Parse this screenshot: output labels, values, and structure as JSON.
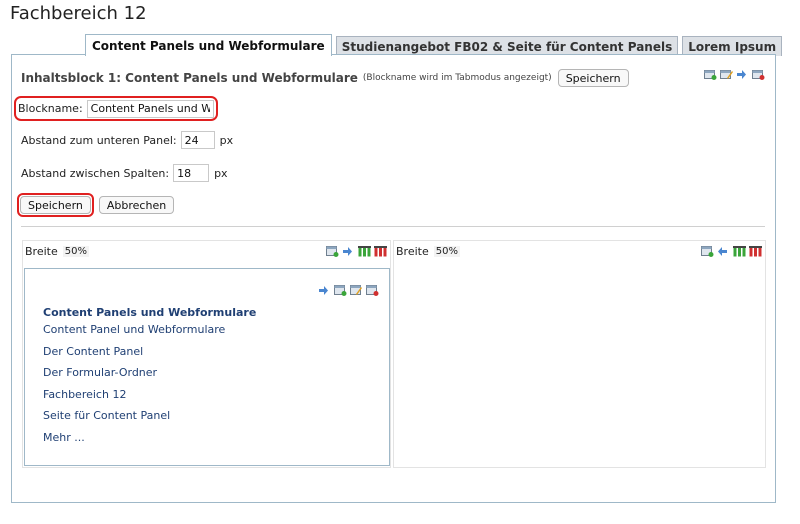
{
  "page_title": "Fachbereich 12",
  "tabs": [
    {
      "label": "Content Panels und Webformulare",
      "active": true
    },
    {
      "label": "Studienangebot FB02 & Seite für Content Panels",
      "active": false
    },
    {
      "label": "Lorem Ipsum",
      "active": false
    }
  ],
  "block": {
    "title": "Inhaltsblock 1: Content Panels und Webformulare",
    "hint": "(Blockname wird im Tabmodus angezeigt)",
    "save_label": "Speichern",
    "toolbar_icons": [
      "add-block-icon",
      "edit-block-icon",
      "move-right-icon",
      "delete-block-icon"
    ]
  },
  "form": {
    "blockname_label": "Blockname:",
    "blockname_value": "Content Panels und Webformulare",
    "gap_bottom_label": "Abstand zum unteren Panel:",
    "gap_bottom_value": "24",
    "gap_columns_label": "Abstand zwischen Spalten:",
    "gap_columns_value": "18",
    "unit": "px",
    "save_label": "Speichern",
    "cancel_label": "Abbrechen"
  },
  "columns": {
    "left": {
      "width_label": "Breite",
      "width_value": "50%",
      "icons": [
        "add-panel-icon",
        "move-right-icon",
        "columns-icon",
        "delete-column-icon"
      ]
    },
    "right": {
      "width_label": "Breite",
      "width_value": "50%",
      "icons": [
        "add-panel-icon",
        "move-left-icon",
        "columns-icon",
        "delete-column-icon"
      ]
    }
  },
  "panel": {
    "icons": [
      "move-right-icon",
      "add-panel-icon",
      "edit-panel-icon",
      "delete-panel-icon"
    ],
    "title": "Content Panels und Webformulare",
    "links": [
      "Content Panel und Webformulare",
      "Der Content Panel",
      "Der Formular-Ordner",
      "Fachbereich 12",
      "Seite für Content Panel",
      "Mehr ..."
    ]
  },
  "colors": {
    "accent_border": "#9fb8c8",
    "highlight": "#e02020",
    "link": "#1f3f73"
  }
}
